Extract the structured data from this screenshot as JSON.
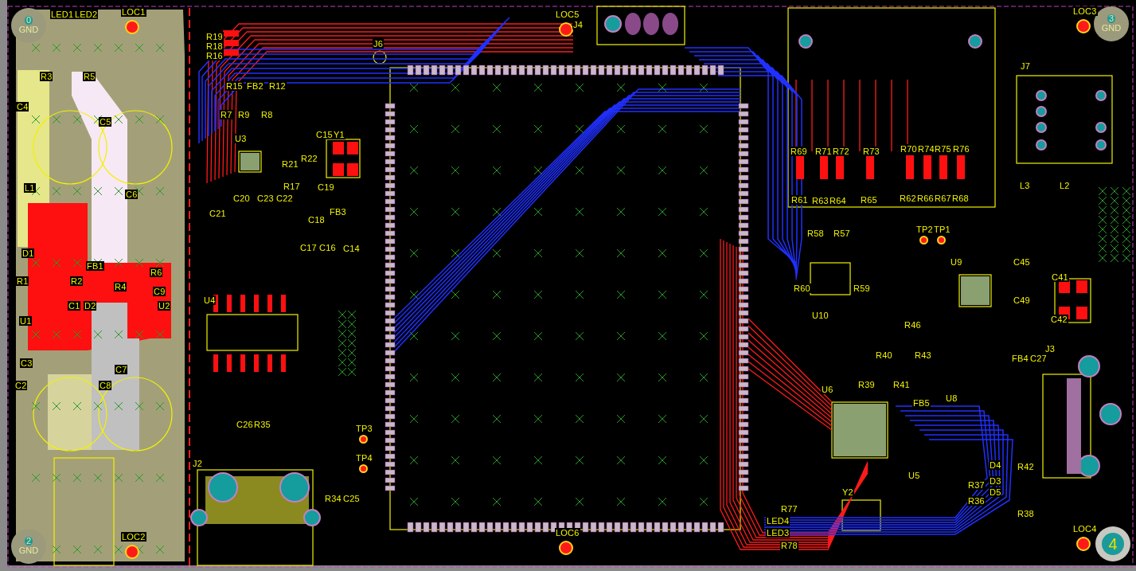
{
  "board": {
    "mounting_holes": [
      {
        "number": "0",
        "net": "GND"
      },
      {
        "number": "3",
        "net": "GND"
      },
      {
        "number": "2",
        "net": "GND"
      },
      {
        "number": "4"
      }
    ],
    "designators": [
      {
        "kind": "part",
        "text": "LED1"
      },
      {
        "kind": "part",
        "text": "LED2"
      },
      {
        "kind": "locator",
        "text": "LOC1"
      },
      {
        "kind": "part",
        "text": "R3"
      },
      {
        "kind": "part",
        "text": "R5"
      },
      {
        "kind": "part",
        "text": "C4"
      },
      {
        "kind": "part",
        "text": "C5"
      },
      {
        "kind": "part",
        "text": "L1"
      },
      {
        "kind": "part",
        "text": "C6"
      },
      {
        "kind": "part",
        "text": "D1"
      },
      {
        "kind": "part",
        "text": "FB1"
      },
      {
        "kind": "part",
        "text": "R1"
      },
      {
        "kind": "part",
        "text": "R2"
      },
      {
        "kind": "part",
        "text": "R6"
      },
      {
        "kind": "part",
        "text": "R4"
      },
      {
        "kind": "part",
        "text": "C9"
      },
      {
        "kind": "part",
        "text": "C1"
      },
      {
        "kind": "part",
        "text": "D2"
      },
      {
        "kind": "part",
        "text": "U2"
      },
      {
        "kind": "part",
        "text": "U1"
      },
      {
        "kind": "part",
        "text": "C3"
      },
      {
        "kind": "part",
        "text": "C7"
      },
      {
        "kind": "part",
        "text": "C2"
      },
      {
        "kind": "part",
        "text": "C8"
      },
      {
        "kind": "locator",
        "text": "LOC2"
      },
      {
        "kind": "part",
        "text": "R19"
      },
      {
        "kind": "part",
        "text": "R18"
      },
      {
        "kind": "part",
        "text": "R16"
      },
      {
        "kind": "part",
        "text": "J6"
      },
      {
        "kind": "part",
        "text": "R15"
      },
      {
        "kind": "part",
        "text": "FB2"
      },
      {
        "kind": "part",
        "text": "R12"
      },
      {
        "kind": "part",
        "text": "R7"
      },
      {
        "kind": "part",
        "text": "R9"
      },
      {
        "kind": "part",
        "text": "R8"
      },
      {
        "kind": "part",
        "text": "C15"
      },
      {
        "kind": "part",
        "text": "Y1"
      },
      {
        "kind": "part",
        "text": "U3"
      },
      {
        "kind": "part",
        "text": "R22"
      },
      {
        "kind": "part",
        "text": "R21"
      },
      {
        "kind": "part",
        "text": "R17"
      },
      {
        "kind": "part",
        "text": "C19"
      },
      {
        "kind": "part",
        "text": "C20"
      },
      {
        "kind": "part",
        "text": "C23"
      },
      {
        "kind": "part",
        "text": "C22"
      },
      {
        "kind": "part",
        "text": "C21"
      },
      {
        "kind": "part",
        "text": "FB3"
      },
      {
        "kind": "part",
        "text": "C18"
      },
      {
        "kind": "part",
        "text": "C17"
      },
      {
        "kind": "part",
        "text": "C16"
      },
      {
        "kind": "part",
        "text": "C14"
      },
      {
        "kind": "part",
        "text": "U4"
      },
      {
        "kind": "part",
        "text": "C26"
      },
      {
        "kind": "part",
        "text": "R35"
      },
      {
        "kind": "part",
        "text": "J2"
      },
      {
        "kind": "testpoint",
        "text": "TP3"
      },
      {
        "kind": "testpoint",
        "text": "TP4"
      },
      {
        "kind": "part",
        "text": "R34"
      },
      {
        "kind": "part",
        "text": "C25"
      },
      {
        "kind": "locator",
        "text": "LOC5"
      },
      {
        "kind": "part",
        "text": "J4"
      },
      {
        "kind": "locator",
        "text": "LOC6"
      },
      {
        "kind": "locator",
        "text": "LOC3"
      },
      {
        "kind": "part",
        "text": "J7"
      },
      {
        "kind": "part",
        "text": "R69"
      },
      {
        "kind": "part",
        "text": "R71"
      },
      {
        "kind": "part",
        "text": "R72"
      },
      {
        "kind": "part",
        "text": "R73"
      },
      {
        "kind": "part",
        "text": "R70"
      },
      {
        "kind": "part",
        "text": "R74"
      },
      {
        "kind": "part",
        "text": "R75"
      },
      {
        "kind": "part",
        "text": "R76"
      },
      {
        "kind": "part",
        "text": "R61"
      },
      {
        "kind": "part",
        "text": "R63"
      },
      {
        "kind": "part",
        "text": "R64"
      },
      {
        "kind": "part",
        "text": "R65"
      },
      {
        "kind": "part",
        "text": "R62"
      },
      {
        "kind": "part",
        "text": "R66"
      },
      {
        "kind": "part",
        "text": "R67"
      },
      {
        "kind": "part",
        "text": "R68"
      },
      {
        "kind": "part",
        "text": "L3"
      },
      {
        "kind": "part",
        "text": "L2"
      },
      {
        "kind": "testpoint",
        "text": "TP2"
      },
      {
        "kind": "testpoint",
        "text": "TP1"
      },
      {
        "kind": "part",
        "text": "R58"
      },
      {
        "kind": "part",
        "text": "R57"
      },
      {
        "kind": "part",
        "text": "U9"
      },
      {
        "kind": "part",
        "text": "C45"
      },
      {
        "kind": "part",
        "text": "R60"
      },
      {
        "kind": "part",
        "text": "R59"
      },
      {
        "kind": "part",
        "text": "C41"
      },
      {
        "kind": "part",
        "text": "C49"
      },
      {
        "kind": "part",
        "text": "C42"
      },
      {
        "kind": "part",
        "text": "U10"
      },
      {
        "kind": "part",
        "text": "R46"
      },
      {
        "kind": "part",
        "text": "J3"
      },
      {
        "kind": "part",
        "text": "R40"
      },
      {
        "kind": "part",
        "text": "R43"
      },
      {
        "kind": "part",
        "text": "FB4"
      },
      {
        "kind": "part",
        "text": "C27"
      },
      {
        "kind": "part",
        "text": "R39"
      },
      {
        "kind": "part",
        "text": "R41"
      },
      {
        "kind": "part",
        "text": "U6"
      },
      {
        "kind": "part",
        "text": "U8"
      },
      {
        "kind": "part",
        "text": "FB5"
      },
      {
        "kind": "part",
        "text": "U5"
      },
      {
        "kind": "part",
        "text": "Y2"
      },
      {
        "kind": "part",
        "text": "D4"
      },
      {
        "kind": "part",
        "text": "R42"
      },
      {
        "kind": "part",
        "text": "D3"
      },
      {
        "kind": "part",
        "text": "D5"
      },
      {
        "kind": "part",
        "text": "R36"
      },
      {
        "kind": "part",
        "text": "R37"
      },
      {
        "kind": "part",
        "text": "R38"
      },
      {
        "kind": "locator",
        "text": "LOC4"
      },
      {
        "kind": "part",
        "text": "R77"
      },
      {
        "kind": "part",
        "text": "LED4"
      },
      {
        "kind": "part",
        "text": "LED3"
      },
      {
        "kind": "part",
        "text": "R78"
      }
    ]
  }
}
